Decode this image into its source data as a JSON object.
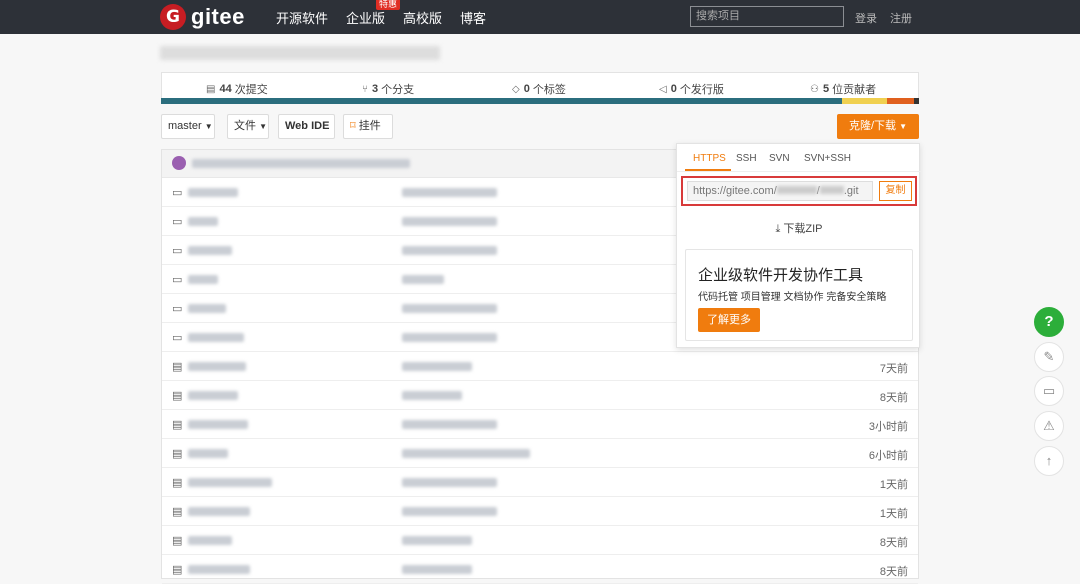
{
  "header": {
    "logo_text": "gitee",
    "logo_mark": "G",
    "nav": [
      {
        "label": "开源软件"
      },
      {
        "label": "企业版",
        "badge": "特惠"
      },
      {
        "label": "高校版"
      },
      {
        "label": "博客"
      }
    ],
    "search_placeholder": "搜索项目",
    "login": "登录",
    "register": "注册"
  },
  "stats": {
    "commits_count": "44",
    "commits_label": "次提交",
    "branches_count": "3",
    "branches_label": "个分支",
    "tags_count": "0",
    "tags_label": "个标签",
    "releases_count": "0",
    "releases_label": "个发行版",
    "contributors_count": "5",
    "contributors_label": "位贡献者"
  },
  "language_bar": {
    "colors": [
      "#2b6e7e",
      "#f0d050",
      "#e0601e",
      "#333333"
    ],
    "fractions": [
      0.898,
      0.06,
      0.035,
      0.007
    ]
  },
  "toolbar": {
    "branch": "master",
    "files": "文件",
    "web_ide": "Web IDE",
    "bookmark": "挂件",
    "clone": "克隆/下载"
  },
  "clone_panel": {
    "tabs": [
      "HTTPS",
      "SSH",
      "SVN",
      "SVN+SSH"
    ],
    "active_tab": "HTTPS",
    "url_prefix": "https://gitee.com/",
    "url_suffix": ".git",
    "copy": "复制",
    "download_zip": "下载ZIP",
    "ad_title": "企业级软件开发协作工具",
    "ad_subtitle": "代码托管 项目管理 文档协作 完备安全策略",
    "ad_button": "了解更多"
  },
  "files": {
    "times": [
      "7天前",
      "8天前",
      "3小时前",
      "6小时前",
      "1天前",
      "1天前",
      "8天前",
      "8天前"
    ]
  },
  "floating": {
    "help": "?",
    "colors": {
      "help": "#2cae3a",
      "accent": "#f07c0e"
    }
  }
}
